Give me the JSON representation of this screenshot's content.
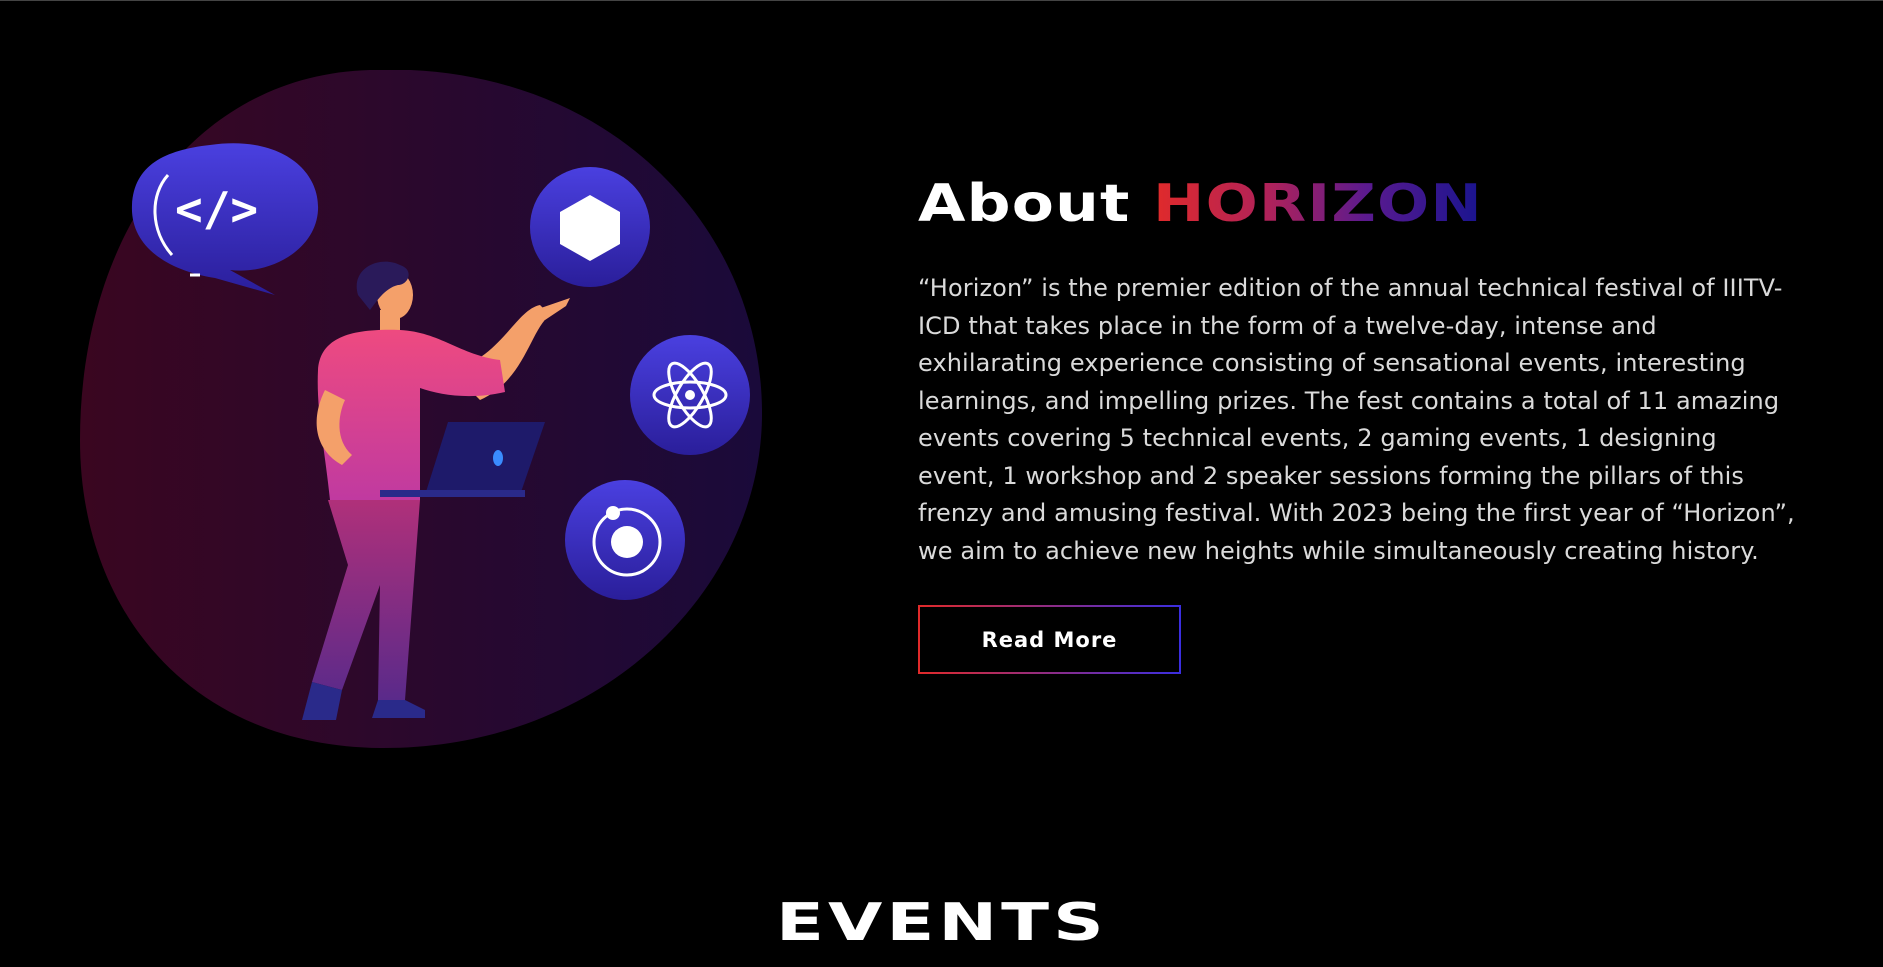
{
  "about": {
    "title_prefix": "About",
    "title_accent": "HORIZON",
    "description": "“Horizon” is the premier edition of the annual technical festival of IIITV-ICD that takes place in the form of a twelve-day, intense and exhilarating experience consisting of sensational events, interesting learnings, and impelling prizes. The fest contains a total of 11 amazing events covering 5 technical events, 2 gaming events, 1 designing event, 1 workshop and 2 speaker sessions forming the pillars of this frenzy and amusing festival. With 2023 being the first year of “Horizon”, we aim to achieve new heights while simultaneously creating history.",
    "read_more_label": "Read More"
  },
  "events": {
    "heading": "EVENTS"
  },
  "illustration": {
    "icons": [
      "code-bubble-icon",
      "hexagon-icon",
      "atom-icon",
      "ionic-icon"
    ],
    "colors": {
      "blob_left": "#3a0620",
      "blob_right": "#1a0a3a",
      "icon_fill": "#3b2ec4",
      "shirt": "#e04a8a",
      "pants": "#8a2a8a",
      "skin": "#f4a06a",
      "hair": "#2a1a5a",
      "laptop": "#1e1a6a"
    }
  },
  "colors": {
    "accent_start": "#e12a2a",
    "accent_end": "#18148f",
    "text": "#dadada",
    "background": "#000000"
  }
}
